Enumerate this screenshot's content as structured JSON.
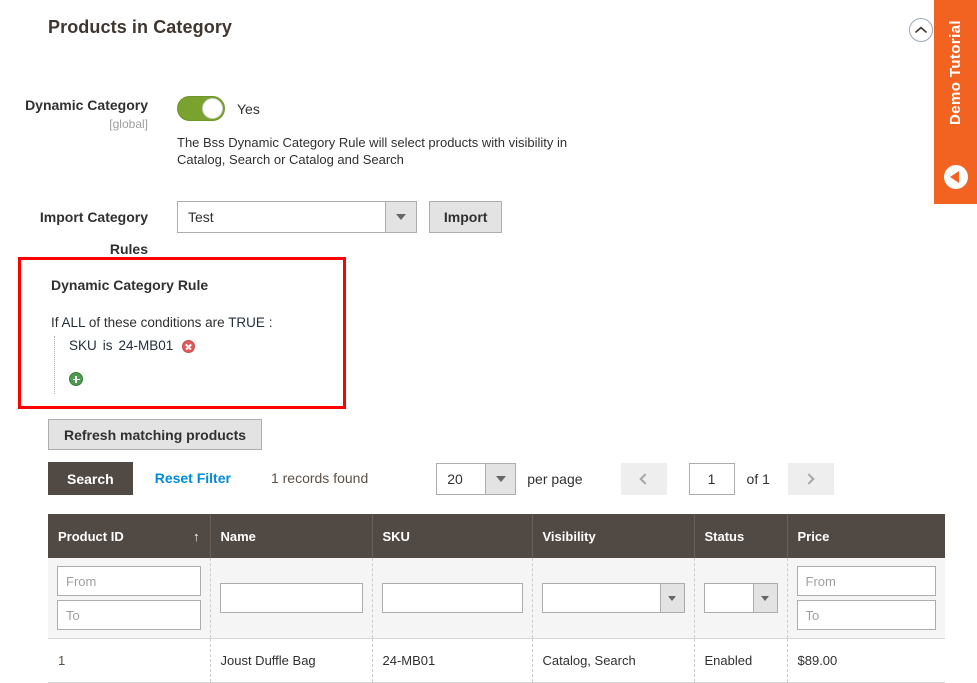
{
  "section": {
    "title": "Products in Category",
    "collapse_icon": "chevron-up-icon"
  },
  "demo_tab": {
    "label": "Demo Tutorial",
    "arrow_icon": "circle-left-arrow-icon",
    "color": "#f26322"
  },
  "dynamic_category": {
    "label": "Dynamic Category",
    "scope": "[global]",
    "toggle_value": "Yes",
    "toggle_on": true,
    "toggle_color": "#79a22e",
    "help_text": "The Bss Dynamic Category Rule will select products with visibility in Catalog, Search or Catalog and Search"
  },
  "import_rules": {
    "label": "Import Category Rules",
    "selected": "Test",
    "button_label": "Import",
    "dropdown_icon": "chevron-down-icon"
  },
  "rule_box": {
    "highlight_color": "#ff0000",
    "title": "Dynamic Category Rule",
    "conditions_prefix": "If",
    "aggregator": "ALL",
    "conditions_middle": "of these conditions are",
    "value_flag": "TRUE",
    "conditions_suffix": ":",
    "conditions": [
      {
        "attribute": "SKU",
        "operator": "is",
        "value": "24-MB01",
        "remove_icon": "remove-circle-icon"
      }
    ],
    "add_icon": "add-circle-icon"
  },
  "refresh": {
    "label": "Refresh matching products"
  },
  "toolbar": {
    "search_label": "Search",
    "reset_label": "Reset Filter",
    "records_found": "1 records found",
    "per_page_value": "20",
    "per_page_label": "per page",
    "prev_icon": "chevron-left-icon",
    "next_icon": "chevron-right-icon",
    "page_value": "1",
    "of_label": "of 1"
  },
  "grid": {
    "columns": [
      {
        "label": "Product ID",
        "sorted": true,
        "sort_icon": "↑"
      },
      {
        "label": "Name",
        "sorted": false,
        "sort_icon": ""
      },
      {
        "label": "SKU",
        "sorted": false,
        "sort_icon": ""
      },
      {
        "label": "Visibility",
        "sorted": false,
        "sort_icon": ""
      },
      {
        "label": "Status",
        "sorted": false,
        "sort_icon": ""
      },
      {
        "label": "Price",
        "sorted": false,
        "sort_icon": ""
      }
    ],
    "filters": {
      "product_id_from": "",
      "product_id_from_placeholder": "From",
      "product_id_to": "",
      "product_id_to_placeholder": "To",
      "name": "",
      "sku": "",
      "visibility": "",
      "status": "",
      "price_from": "",
      "price_from_placeholder": "From",
      "price_to": "",
      "price_to_placeholder": "To"
    },
    "rows": [
      {
        "product_id": "1",
        "name": "Joust Duffle Bag",
        "sku": "24-MB01",
        "visibility": "Catalog, Search",
        "status": "Enabled",
        "price": "$89.00"
      }
    ]
  }
}
